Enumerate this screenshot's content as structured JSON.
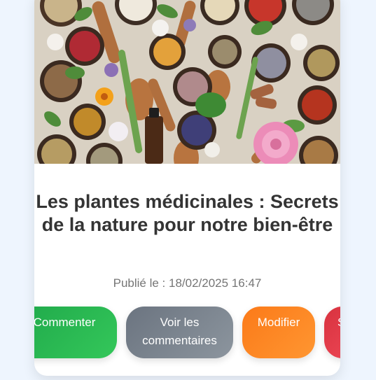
{
  "article": {
    "image_subject": "herbs-and-spices-bowls",
    "title": "Les plantes médicinales : Secrets de la nature pour notre bien-être",
    "published": "Publié le : 18/02/2025 16:47"
  },
  "actions": {
    "comment": "Commenter",
    "view_comments": "Voir les commentaires",
    "edit": "Modifier",
    "delete": "S"
  },
  "colors": {
    "page_bg": "#eef5fe",
    "comment": "#28b84f",
    "view_comments": "#7c858e",
    "edit": "#fd8623",
    "delete": "#e23e4b"
  }
}
